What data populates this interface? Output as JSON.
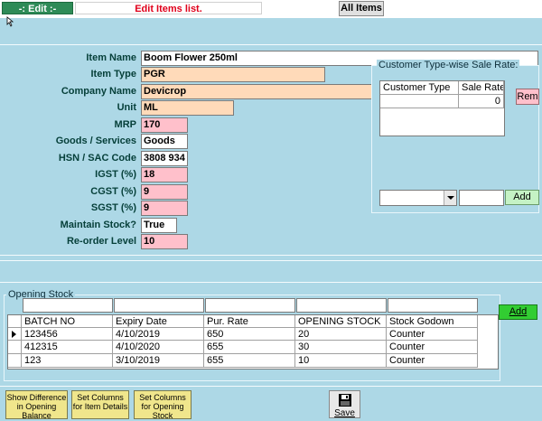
{
  "header": {
    "mode_label": "-: Edit :-",
    "title": "Edit  Items list.",
    "all_items_button": "All Items"
  },
  "form": {
    "fields": [
      {
        "label": "Item Name",
        "value": "Boom Flower 250ml"
      },
      {
        "label": "Item Type",
        "value": "PGR"
      },
      {
        "label": "Company Name",
        "value": "Devicrop"
      },
      {
        "label": "Unit",
        "value": "ML"
      },
      {
        "label": "MRP",
        "value": "170"
      },
      {
        "label": "Goods / Services",
        "value": "Goods"
      },
      {
        "label": "HSN / SAC Code",
        "value": "3808 934"
      },
      {
        "label": "IGST (%)",
        "value": "18"
      },
      {
        "label": "CGST (%)",
        "value": "9"
      },
      {
        "label": "SGST (%)",
        "value": "9"
      },
      {
        "label": "Maintain Stock?",
        "value": "True"
      },
      {
        "label": "Re-order Level",
        "value": "10"
      }
    ]
  },
  "sale_rate": {
    "title": "Customer Type-wise Sale Rate:",
    "columns": [
      "Customer Type",
      "Sale Rate"
    ],
    "rows": [
      {
        "customer_type": "",
        "sale_rate": "0"
      }
    ],
    "remove_button": "Rem",
    "add_button": "Add"
  },
  "opening_stock": {
    "title": "Opening Stock",
    "columns": [
      "BATCH NO",
      "Expiry Date",
      "Pur. Rate",
      "OPENING STOCK",
      "Stock Godown"
    ],
    "rows": [
      [
        "123456",
        "4/10/2019",
        "650",
        "20",
        "Counter"
      ],
      [
        "412315",
        "4/10/2020",
        "655",
        "30",
        "Counter"
      ],
      [
        "123",
        "3/10/2019",
        "655",
        "10",
        "Counter"
      ]
    ],
    "add_button": "Add"
  },
  "footer": {
    "btn_diff": "Show Difference in Opening Balance",
    "btn_cols_item": "Set Columns for Item Details",
    "btn_cols_stock": "Set Columns for Opening Stock",
    "save_label": "Save"
  }
}
